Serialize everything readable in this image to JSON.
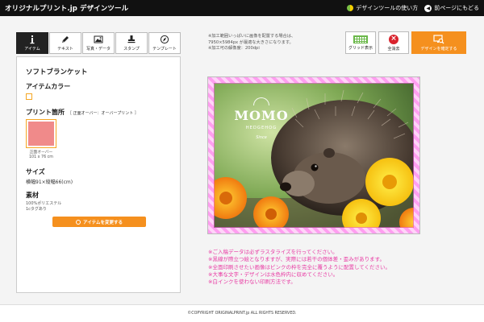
{
  "header": {
    "logo": "オリジナルプリント.jp デザインツール",
    "howto_link": "デザインツールの使い方",
    "back_link": "前ページにもどる"
  },
  "tabs": [
    {
      "label": "アイテム",
      "icon": "info-icon",
      "active": true
    },
    {
      "label": "テキスト",
      "icon": "pen-icon",
      "active": false
    },
    {
      "label": "写真・データ",
      "icon": "image-icon",
      "active": false
    },
    {
      "label": "スタンプ",
      "icon": "stamp-icon",
      "active": false
    },
    {
      "label": "テンプレート",
      "icon": "compass-icon",
      "active": false
    }
  ],
  "notes": [
    "※加工範囲いっぱいに画像を配置する場合は、",
    "7950×5984px が最適な大きさになります。",
    "※加工可の解像度：200dpi"
  ],
  "toolbar": {
    "grid_label": "グリッド表示",
    "clear_label": "全消去",
    "confirm_label": "デザインを確定する"
  },
  "item": {
    "product_name": "ソフトブランケット",
    "color_heading": "アイテムカラー",
    "print_heading": "プリント箇所",
    "print_note": "［ 正面オーバー：オーバープリント ］",
    "thumb_caption_1": "正面オーバー",
    "thumb_caption_2": "101 x 76 cm",
    "size_heading": "サイズ",
    "size_value": "横幅91×縦幅66(cm)",
    "material_heading": "素材",
    "material_line_1": "100%ポリエステル",
    "material_line_2": "1cタグあり",
    "change_button": "アイテムを変更する",
    "print_color": "#f08a8a",
    "accent_color": "#f5901e"
  },
  "design": {
    "badge_title": "MOMO",
    "badge_sub": "HEDGEHOG",
    "badge_foot": "Since"
  },
  "warnings": [
    "※ご入稿データは必ずラスタライズを行ってください。",
    "※黒線が際立つ絵となりますが、実際には若干の個体差・歪みがあります。",
    "※全面印刷させたい画像はピンクの枠を完全に覆うように配置してください。",
    "※大事な文字・デザインは水色枠内に収めてください。",
    "※白インクを使わない印刷方法です。"
  ],
  "footer": {
    "copyright": "©COPYRIGHT ORIGINALPRINT.jp ALL RIGHTS RESERVED."
  }
}
